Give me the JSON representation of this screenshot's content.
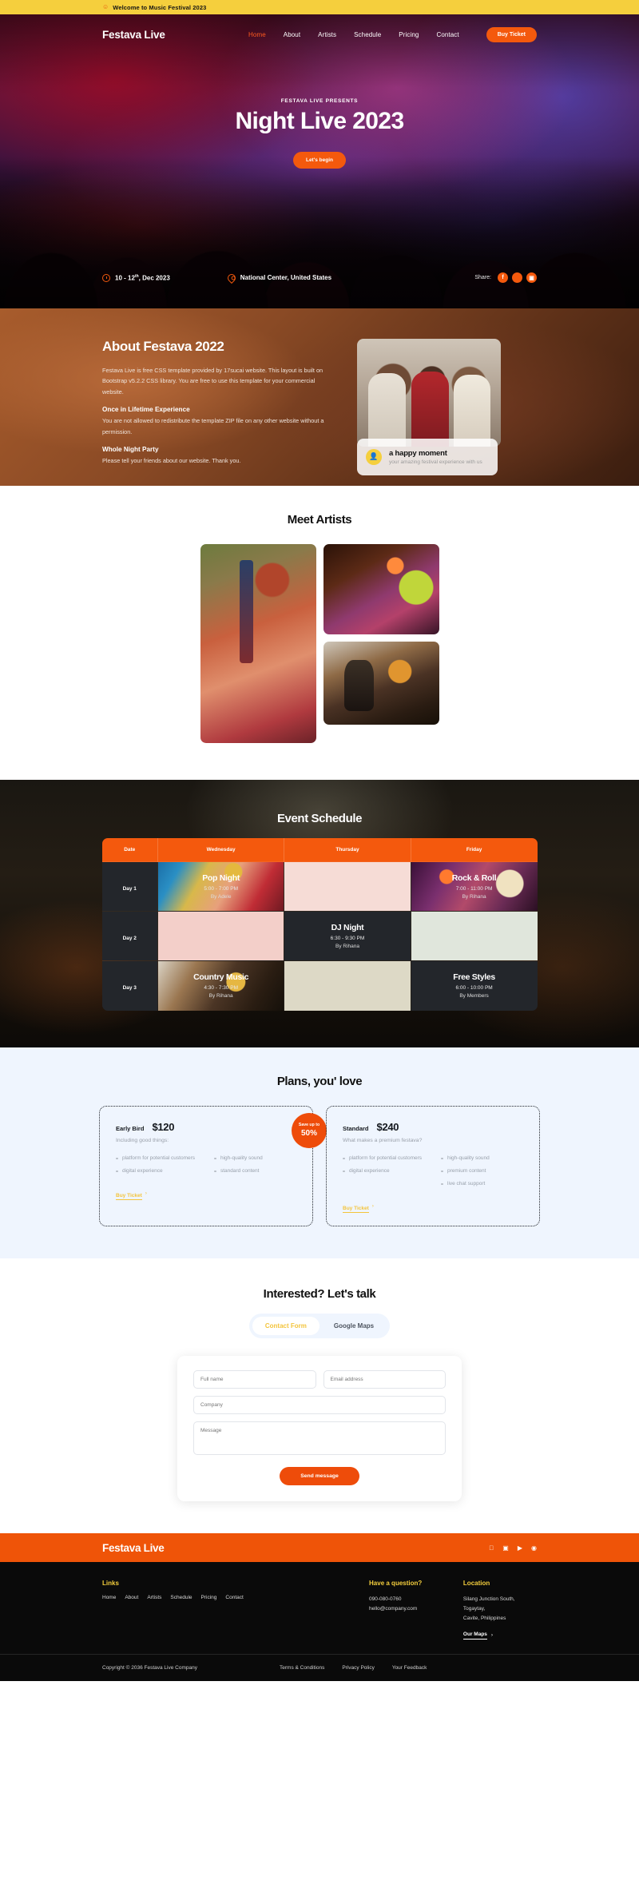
{
  "topbar": {
    "icon": "user-icon",
    "text": "Welcome to Music Festival 2023"
  },
  "nav": {
    "brand": "Festava Live",
    "links": [
      {
        "label": "Home",
        "active": true
      },
      {
        "label": "About",
        "active": false
      },
      {
        "label": "Artists",
        "active": false
      },
      {
        "label": "Schedule",
        "active": false
      },
      {
        "label": "Pricing",
        "active": false
      },
      {
        "label": "Contact",
        "active": false
      }
    ],
    "cta": "Buy Ticket"
  },
  "hero": {
    "kicker": "FESTAVA LIVE PRESENTS",
    "title": "Night Live 2023",
    "cta": "Let's begin",
    "date": "10 - 12th, Dec 2023",
    "date_main": "10 - 12",
    "date_sup": "th",
    "date_rest": ", Dec 2023",
    "location": "National Center, United States",
    "share_label": "Share:",
    "socials": [
      "facebook-icon",
      "twitter-icon",
      "instagram-icon"
    ]
  },
  "about": {
    "heading": "About Festava 2022",
    "paragraph": "Festava Live is free CSS template provided by 17sucai website. This layout is built on Bootstrap v5.2.2 CSS library. You are free to use this template for your commercial website.",
    "sub1_title": "Once in Lifetime Experience",
    "sub1_text": "You are not allowed to redistribute the template ZIP file on any other website without a permission.",
    "sub2_title": "Whole Night Party",
    "sub2_text": "Please tell your friends about our website. Thank you.",
    "card_title": "a happy moment",
    "card_sub": "your amazing festival experience with us",
    "card_icon": "person-icon"
  },
  "artists": {
    "heading": "Meet Artists"
  },
  "schedule": {
    "heading": "Event Schedule",
    "columns": [
      "Date",
      "Wednesday",
      "Thursday",
      "Friday"
    ],
    "rows": [
      {
        "day": "Day 1",
        "cells": [
          {
            "title": "Pop Night",
            "time": "5:00 - 7:00 PM",
            "by": "By Adele",
            "style": "bg-pop"
          },
          {
            "title": "",
            "time": "",
            "by": "",
            "style": "fill-pink"
          },
          {
            "title": "Rock & Roll",
            "time": "7:00 - 11:00 PM",
            "by": "By Rihana",
            "style": "bg-rock"
          }
        ]
      },
      {
        "day": "Day 2",
        "cells": [
          {
            "title": "",
            "time": "",
            "by": "",
            "style": "fill-pink2"
          },
          {
            "title": "DJ Night",
            "time": "6:30 - 9:30 PM",
            "by": "By Rihana",
            "style": ""
          },
          {
            "title": "",
            "time": "",
            "by": "",
            "style": "fill-sage"
          }
        ]
      },
      {
        "day": "Day 3",
        "cells": [
          {
            "title": "Country Music",
            "time": "4:30 - 7:30 PM",
            "by": "By Rihana",
            "style": "bg-country"
          },
          {
            "title": "",
            "time": "",
            "by": "",
            "style": "fill-sand"
          },
          {
            "title": "Free Styles",
            "time": "6:00 - 10:00 PM",
            "by": "By Members",
            "style": ""
          }
        ]
      }
    ]
  },
  "pricing": {
    "heading": "Plans, you' love",
    "badge_text": "Save up to",
    "badge_percent": "50%",
    "cards": [
      {
        "name": "Early Bird",
        "price": "$120",
        "subtitle": "Including good things:",
        "features_col1": [
          "platform for potential customers",
          "digital experience"
        ],
        "features_col2": [
          "high-quality sound",
          "standard content"
        ],
        "cta": "Buy Ticket"
      },
      {
        "name": "Standard",
        "price": "$240",
        "subtitle": "What makes a premium festava?",
        "features_col1": [
          "platform for potential customers",
          "digital experience"
        ],
        "features_col2": [
          "high-quality sound",
          "premium content",
          "live chat support"
        ],
        "cta": "Buy Ticket"
      }
    ]
  },
  "contact": {
    "heading": "Interested? Let's talk",
    "tabs": [
      {
        "label": "Contact Form",
        "active": true
      },
      {
        "label": "Google Maps",
        "active": false
      }
    ],
    "fields": {
      "fullname": "Full name",
      "email": "Email address",
      "company": "Company",
      "message": "Message"
    },
    "submit": "Send message"
  },
  "footer": {
    "brand": "Festava Live",
    "socials": [
      "twitter-icon",
      "apple-icon",
      "instagram-icon",
      "youtube-icon",
      "pinterest-icon"
    ],
    "links_heading": "Links",
    "links": [
      "Home",
      "About",
      "Artists",
      "Schedule",
      "Pricing",
      "Contact"
    ],
    "question_heading": "Have a question?",
    "phone": "090-080-0760",
    "email": "hello@company.com",
    "location_heading": "Location",
    "address_line1": "Silang Junction South, Togaytay,",
    "address_line2": "Cavite, Philippines",
    "maps_link": "Our Maps",
    "copyright": "Copyright © 2036 Festava Live Company",
    "bottom_links": [
      "Terms & Conditions",
      "Privacy Policy",
      "Your Feedback"
    ]
  }
}
